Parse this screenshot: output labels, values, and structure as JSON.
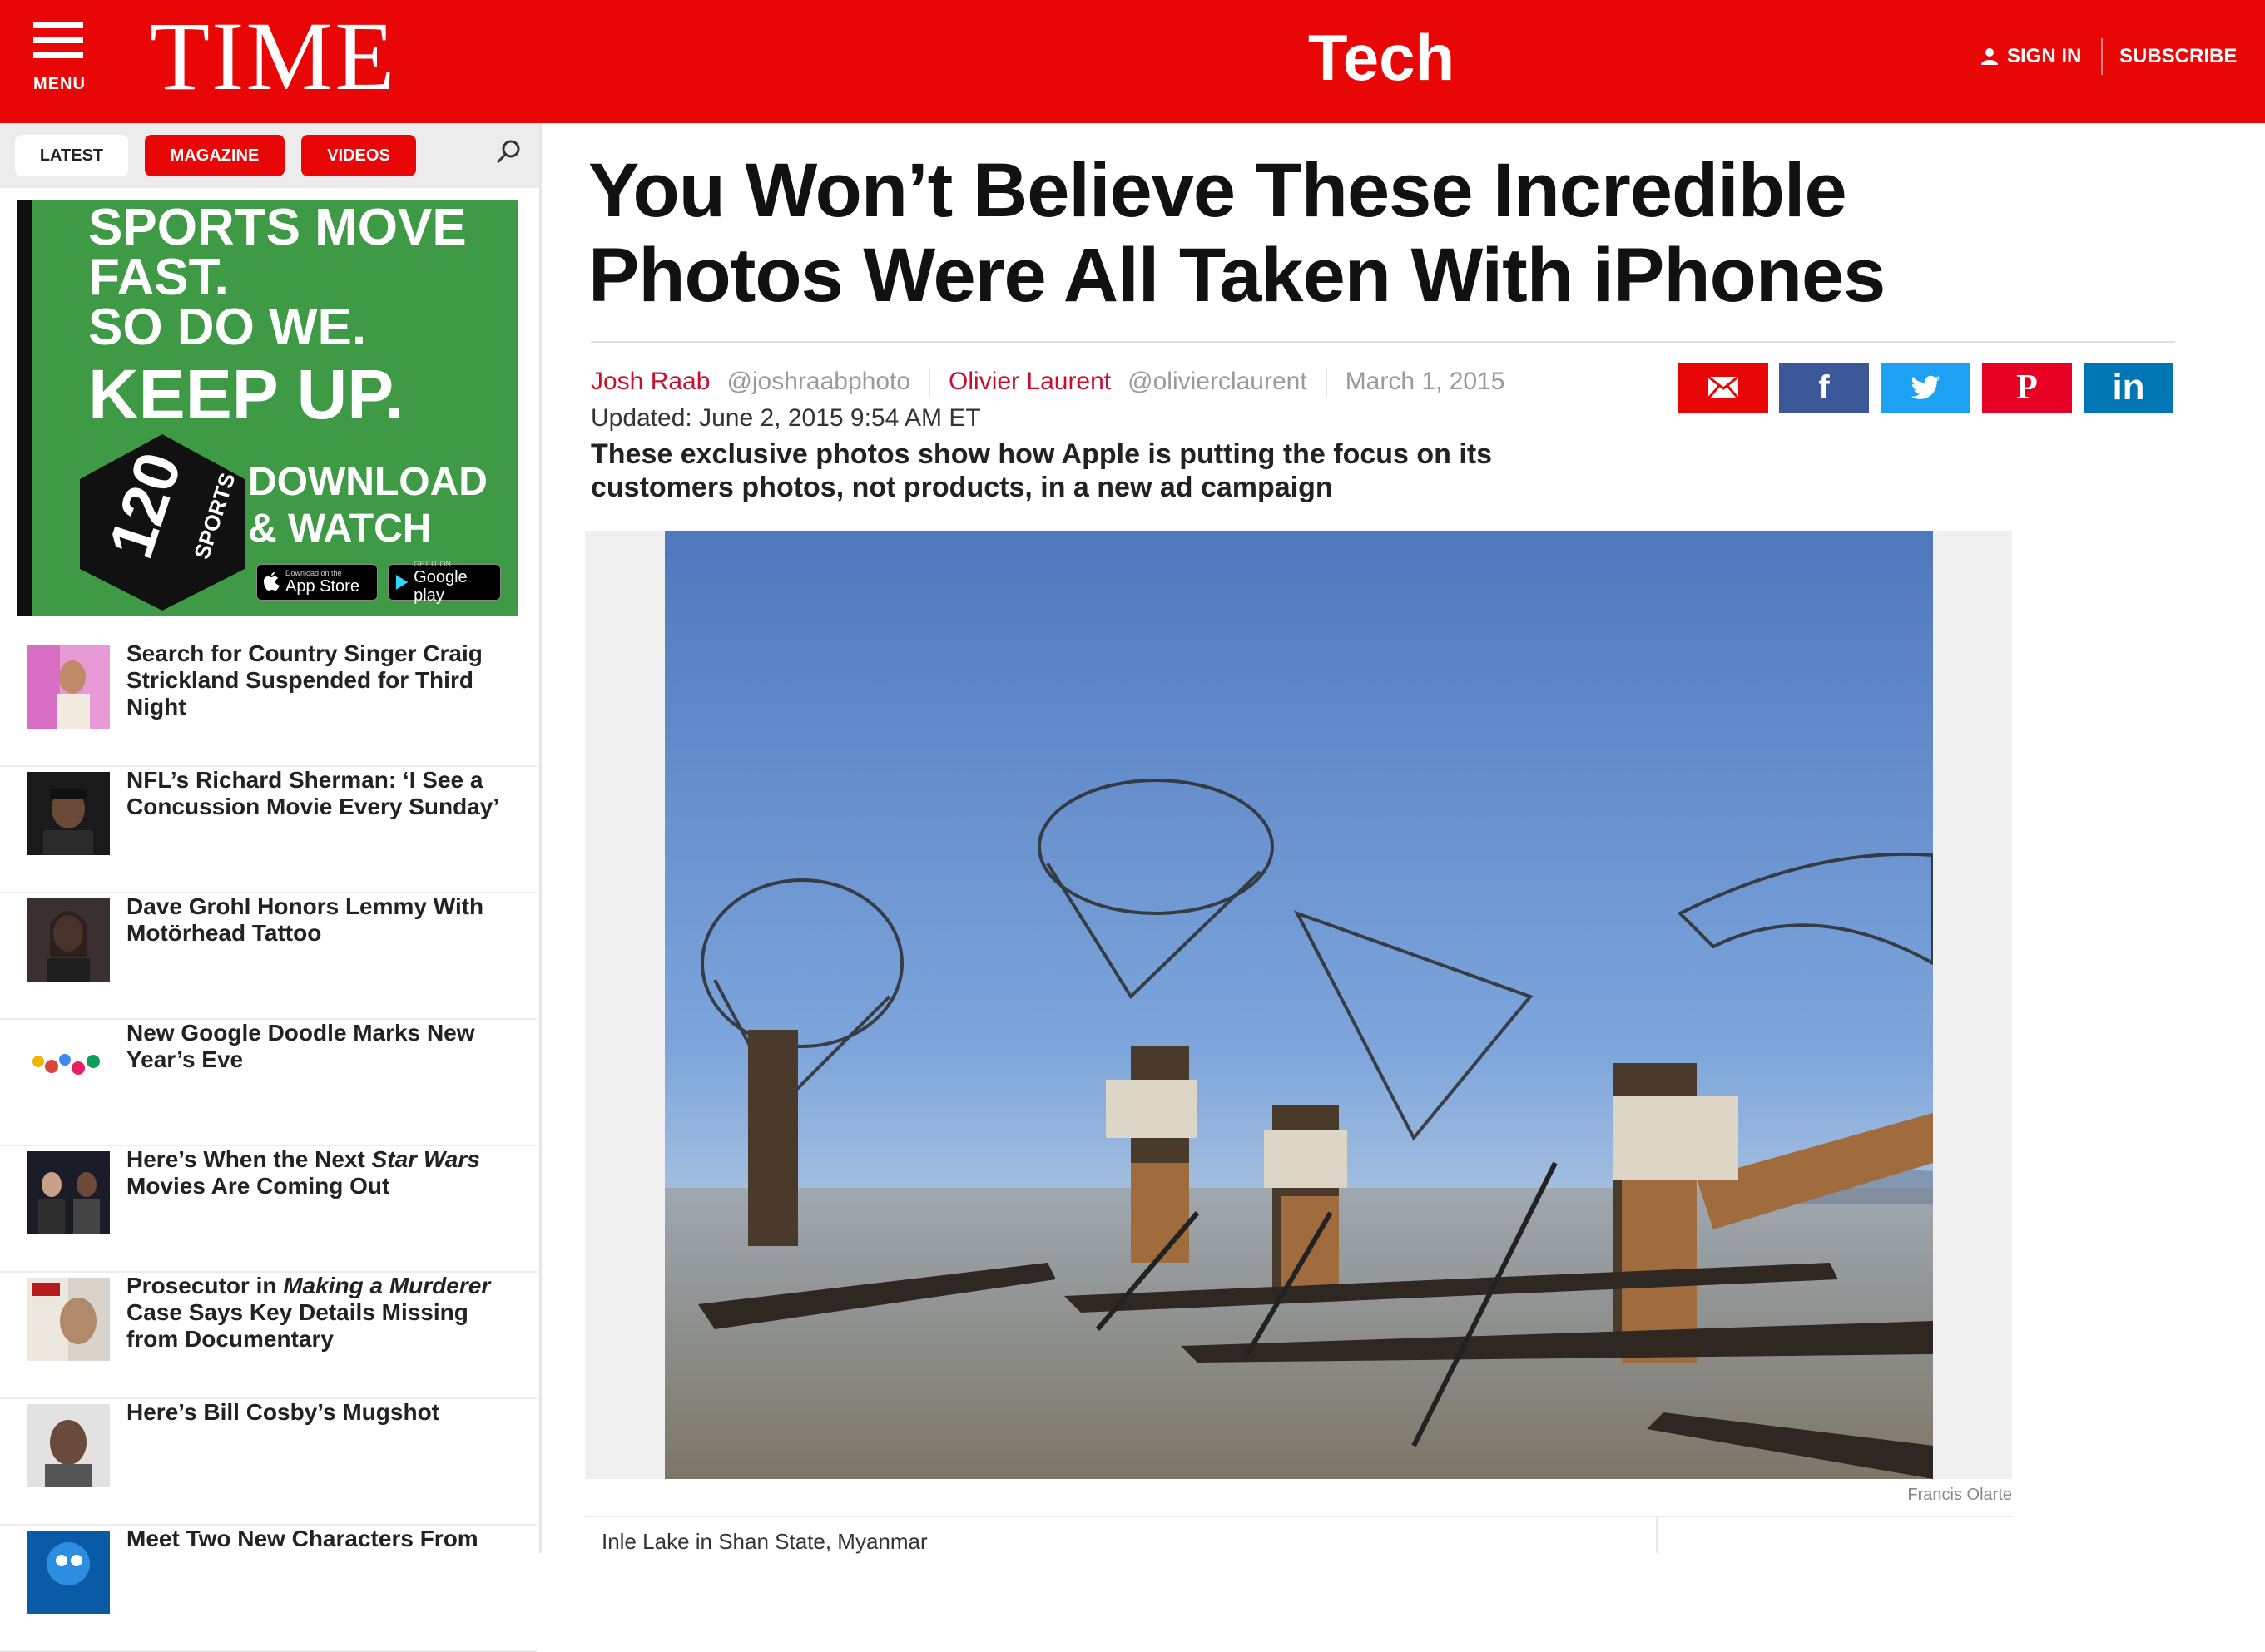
{
  "header": {
    "menu_label": "MENU",
    "logo": "TIME",
    "section": "Tech",
    "sign_in": "SIGN IN",
    "subscribe": "SUBSCRIBE",
    "brand_color": "#e90606"
  },
  "sidebar": {
    "tabs": [
      {
        "label": "LATEST"
      },
      {
        "label": "MAGAZINE"
      },
      {
        "label": "VIDEOS"
      }
    ],
    "ad": {
      "line1": "SPORTS MOVE",
      "line2": "FAST.",
      "line3": "SO DO WE.",
      "line4": "KEEP UP.",
      "brand_number": "120",
      "brand_name": "SPORTS",
      "download1": "DOWNLOAD",
      "download2": "& WATCH",
      "apple_small": "Download on the",
      "apple_big": "App Store",
      "google_small": "GET IT ON",
      "google_big": "Google play"
    },
    "news": [
      {
        "title": "Search for Country Singer Craig Strickland Suspended for Third Night"
      },
      {
        "title": "NFL’s Richard Sherman: ‘I See a Concussion Movie Every Sunday’"
      },
      {
        "title": "Dave Grohl Honors Lemmy With Motörhead Tattoo"
      },
      {
        "title": "New Google Doodle Marks New Year’s Eve"
      },
      {
        "title_pre": "Here’s When the Next ",
        "title_em": "Star Wars",
        "title_post": " Movies Are Coming Out"
      },
      {
        "title_pre": "Prosecutor in ",
        "title_em": "Making a Murderer",
        "title_post": " Case Says Key Details Missing from Documentary"
      },
      {
        "title": "Here’s Bill Cosby’s Mugshot"
      },
      {
        "title": "Meet Two New Characters From"
      }
    ]
  },
  "article": {
    "headline": "You Won’t Believe These Incredible Photos Were All Taken With iPhones",
    "authors": [
      {
        "name": "Josh Raab",
        "handle": "@joshraabphoto"
      },
      {
        "name": "Olivier Laurent",
        "handle": "@olivierclaurent"
      }
    ],
    "date": "March 1, 2015",
    "updated": "Updated: June 2, 2015 9:54 AM ET",
    "dek": "These exclusive photos show how Apple is putting the focus on its customers photos, not products, in a new ad campaign",
    "share": {
      "email_icon": "email-icon",
      "facebook_icon": "facebook-icon",
      "twitter_icon": "twitter-icon",
      "pinterest_icon": "pinterest-icon",
      "linkedin_icon": "linkedin-icon",
      "facebook_glyph": "f",
      "pinterest_glyph": "P",
      "linkedin_glyph": "in"
    },
    "photo_credit": "Francis Olarte",
    "caption": "Inle Lake in Shan State, Myanmar"
  }
}
